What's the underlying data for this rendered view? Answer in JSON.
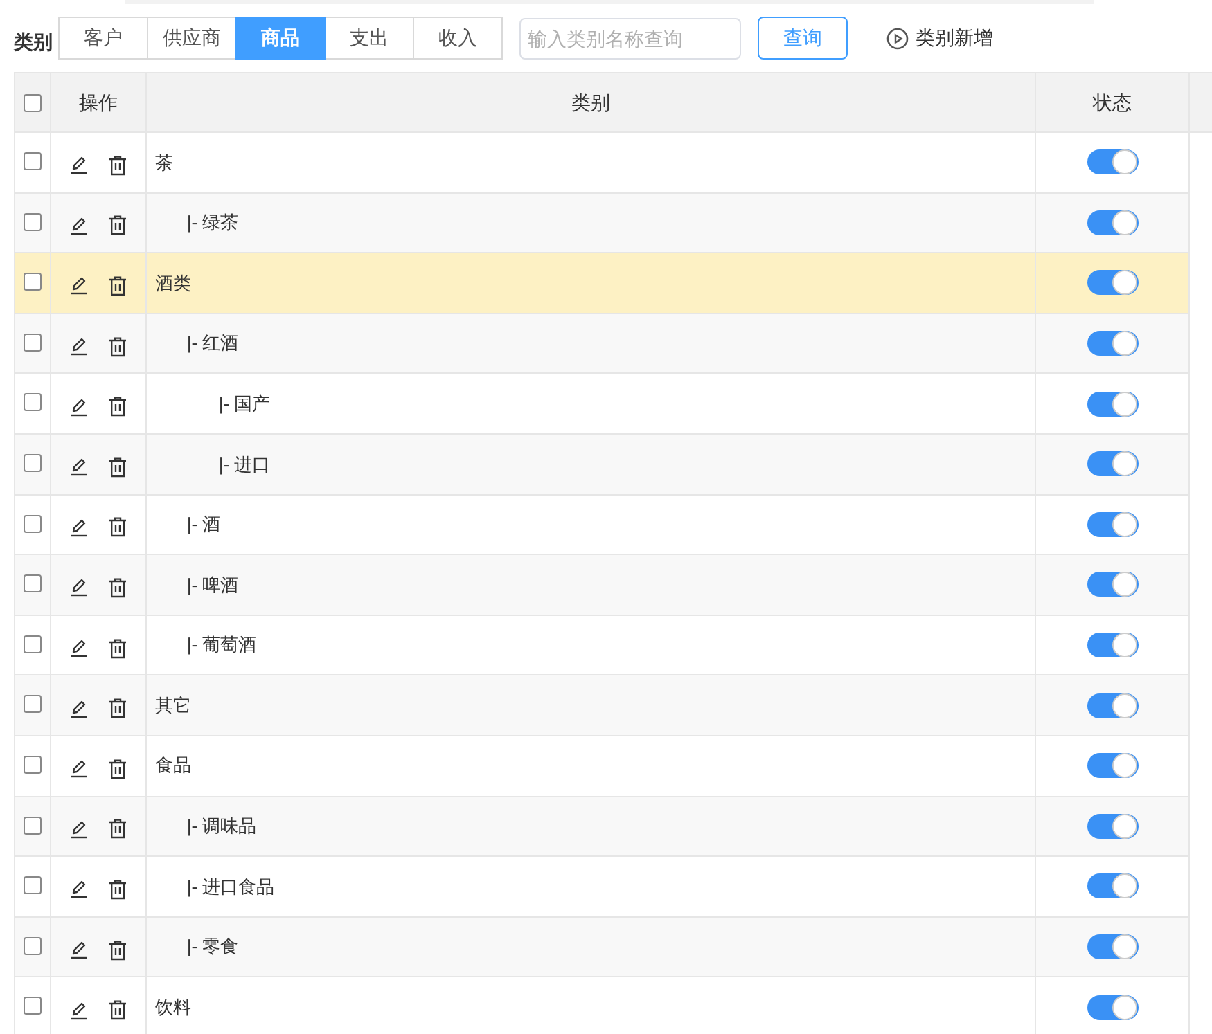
{
  "filter_label": "类别",
  "tabs": [
    {
      "label": "客户",
      "selected": false
    },
    {
      "label": "供应商",
      "selected": false
    },
    {
      "label": "商品",
      "selected": true
    },
    {
      "label": "支出",
      "selected": false
    },
    {
      "label": "收入",
      "selected": false
    }
  ],
  "search": {
    "placeholder": "输入类别名称查询"
  },
  "search_button": "查询",
  "add_link": "类别新增",
  "table": {
    "columns": [
      "操作",
      "类别",
      "状态"
    ],
    "select_all_checked": false,
    "rows": [
      {
        "name": "茶",
        "checked": false,
        "highlighted": false,
        "on": true,
        "children": [
          {
            "name": "|- 绿茶",
            "checked": false,
            "highlighted": false,
            "on": true
          }
        ]
      },
      {
        "name": "酒类",
        "checked": false,
        "highlighted": true,
        "on": true,
        "children": [
          {
            "name": "|- 红酒",
            "checked": false,
            "highlighted": false,
            "on": true,
            "children": [
              {
                "name": "|- 国产",
                "checked": false,
                "highlighted": false,
                "on": true
              },
              {
                "name": "|- 进口",
                "checked": false,
                "highlighted": false,
                "on": true
              }
            ]
          },
          {
            "name": "|- 酒",
            "checked": false,
            "highlighted": false,
            "on": true
          },
          {
            "name": "|- 啤酒",
            "checked": false,
            "highlighted": false,
            "on": true
          },
          {
            "name": "|- 葡萄酒",
            "checked": false,
            "highlighted": false,
            "on": true
          }
        ]
      },
      {
        "name": "其它",
        "checked": false,
        "highlighted": false,
        "on": true
      },
      {
        "name": "食品",
        "checked": false,
        "highlighted": false,
        "on": true,
        "children": [
          {
            "name": "|- 调味品",
            "checked": false,
            "highlighted": false,
            "on": true
          },
          {
            "name": "|- 进口食品",
            "checked": false,
            "highlighted": false,
            "on": true
          },
          {
            "name": "|- 零食",
            "checked": false,
            "highlighted": false,
            "on": true
          }
        ]
      },
      {
        "name": "饮料",
        "checked": false,
        "highlighted": false,
        "on": true
      }
    ]
  }
}
